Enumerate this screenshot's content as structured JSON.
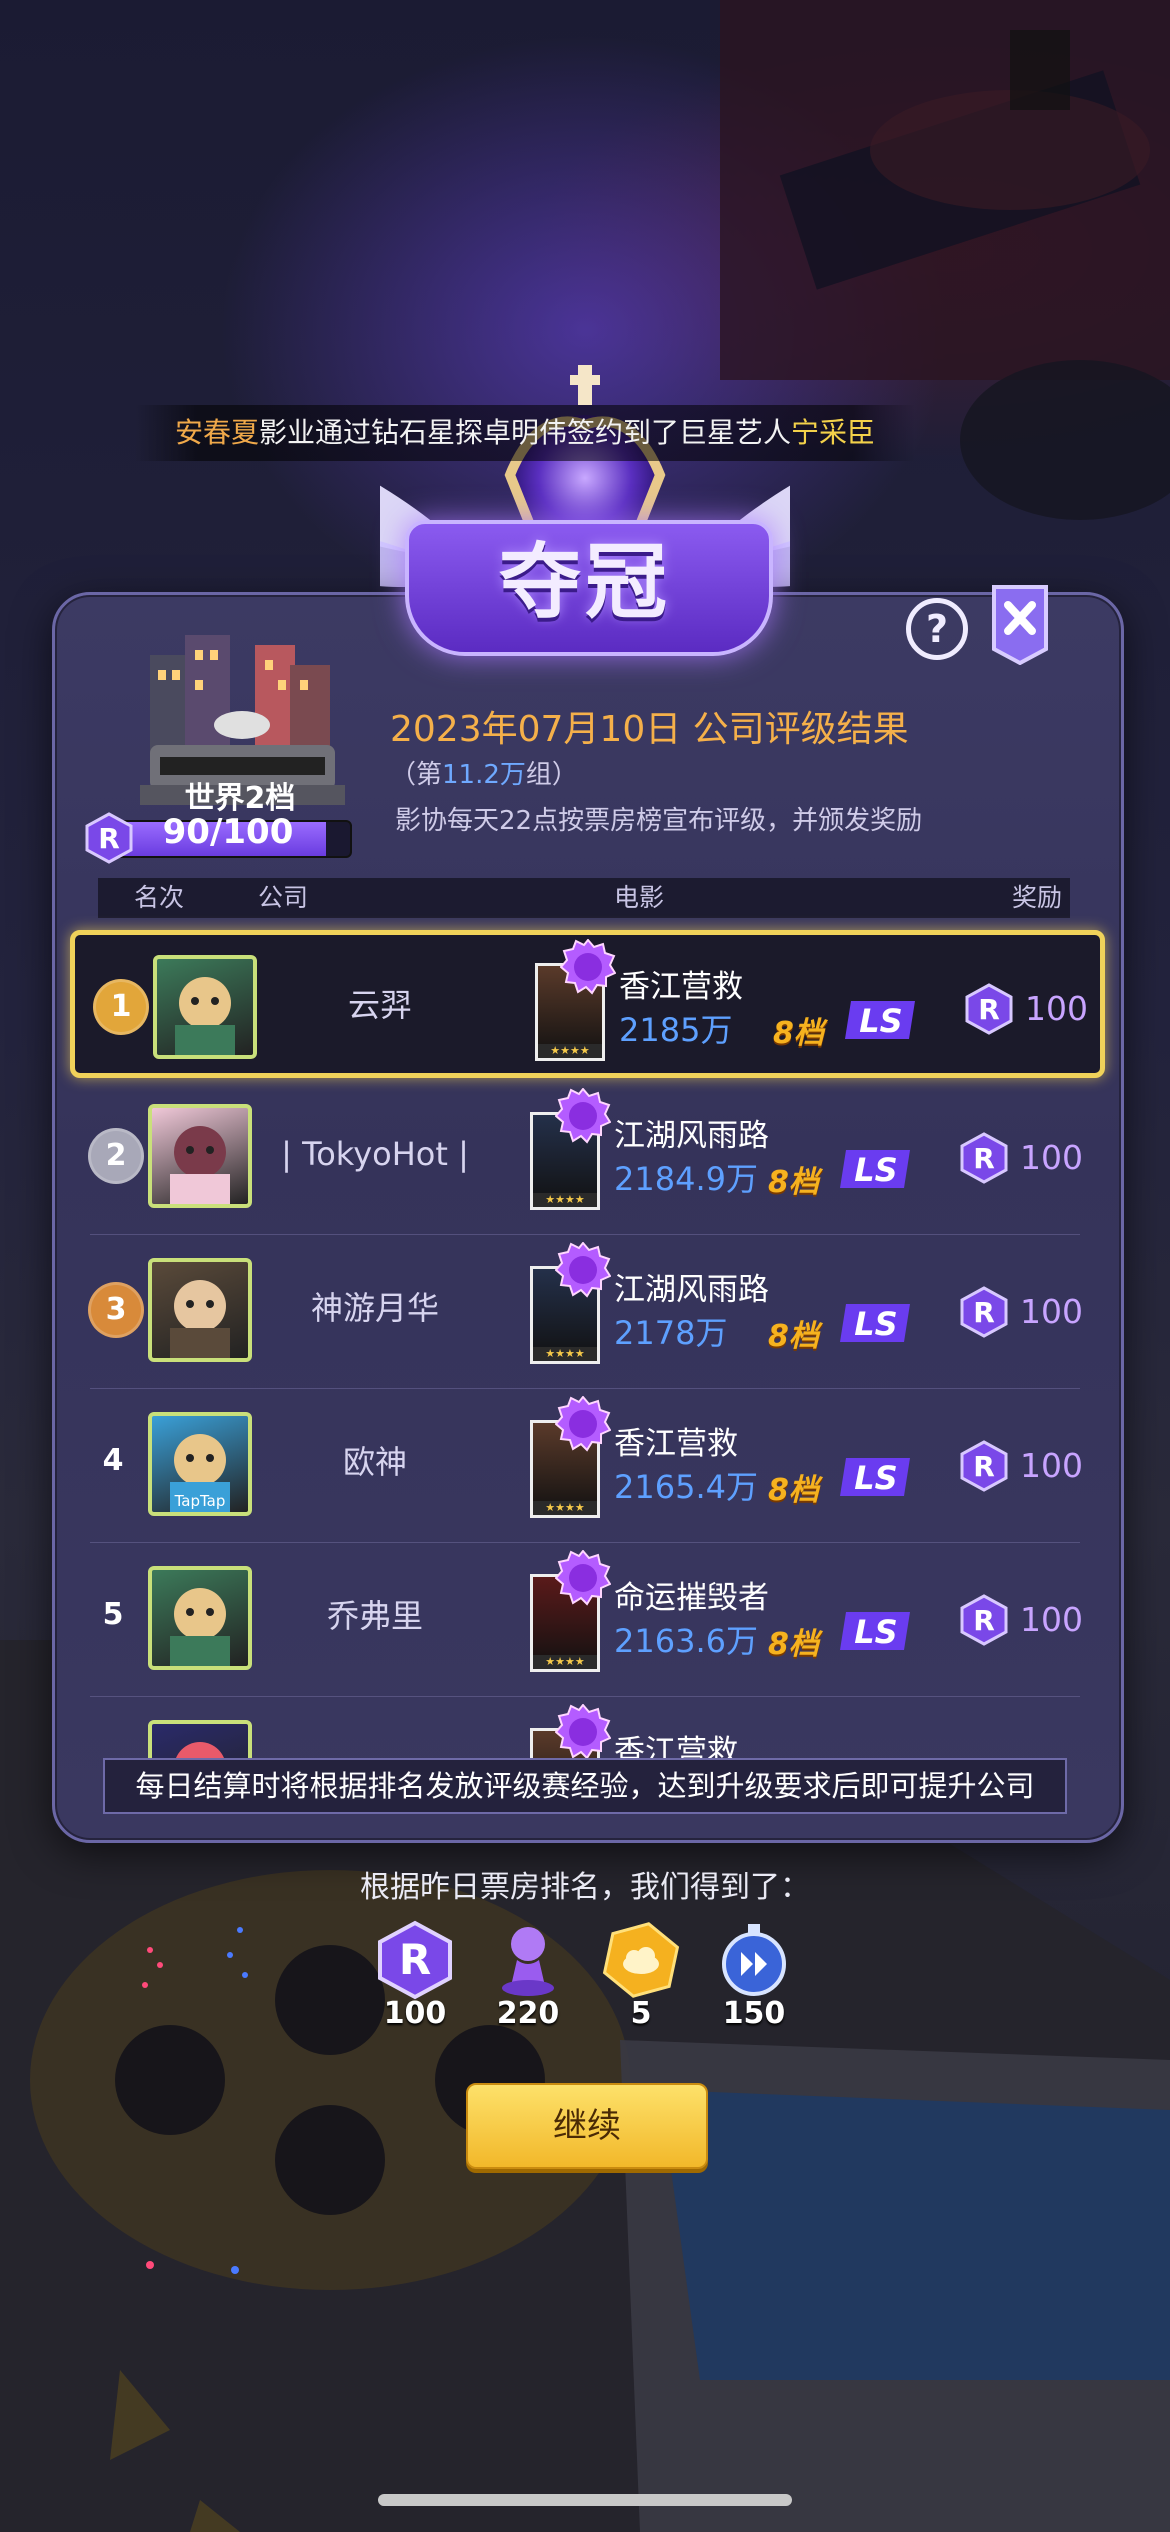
{
  "banner": {
    "name1": "安春夏",
    "mid": "影业通过钻石星探卓明伟签约到了巨星艺人",
    "name2": "宁采臣"
  },
  "title": "夺冠",
  "help_label": "?",
  "rank_badge": {
    "level": "世界2档",
    "progress_text": "90/100",
    "progress_fraction": 0.9
  },
  "result": {
    "title": "2023年07月10日 公司评级结果",
    "group_prefix": "（第",
    "group_value": "11.2万",
    "group_suffix": "组）",
    "description": "影协每天22点按票房榜宣布评级，并颁发奖励"
  },
  "table_header": {
    "rank": "名次",
    "company": "公司",
    "movie": "电影",
    "reward": "奖励"
  },
  "rows": [
    {
      "rank": "1",
      "company": "云羿",
      "movie": "香江营救",
      "box": "2185万",
      "tier": "8档",
      "ls": "LS",
      "reward": "100"
    },
    {
      "rank": "2",
      "company": "| TokyoHot |",
      "movie": "江湖风雨路",
      "box": "2184.9万",
      "tier": "8档",
      "ls": "LS",
      "reward": "100"
    },
    {
      "rank": "3",
      "company": "神游月华",
      "movie": "江湖风雨路",
      "box": "2178万",
      "tier": "8档",
      "ls": "LS",
      "reward": "100"
    },
    {
      "rank": "4",
      "company": "欧神",
      "movie": "香江营救",
      "box": "2165.4万",
      "tier": "8档",
      "ls": "LS",
      "reward": "100"
    },
    {
      "rank": "5",
      "company": "乔弗里",
      "movie": "命运摧毁者",
      "box": "2163.6万",
      "tier": "8档",
      "ls": "LS",
      "reward": "100"
    },
    {
      "movie": "香江营救"
    }
  ],
  "avatar_tag_taptap": "TapTap",
  "footer_note": "每日结算时将根据排名发放评级赛经验，达到升级要求后即可提升公司",
  "gains": {
    "heading": "根据昨日票房排名，我们得到了：",
    "items": [
      {
        "icon": "r-coin-icon",
        "value": "100"
      },
      {
        "icon": "purple-pawn-icon",
        "value": "220"
      },
      {
        "icon": "gold-cloud-hex-icon",
        "value": "5"
      },
      {
        "icon": "speedup-stopwatch-icon",
        "value": "150"
      }
    ]
  },
  "continue_label": "继续",
  "colors": {
    "accent_gold": "#f5b04a",
    "reward_purple": "#c8a4ff",
    "box_blue": "#5ea0ff",
    "highlight_border": "#f0d25a"
  }
}
